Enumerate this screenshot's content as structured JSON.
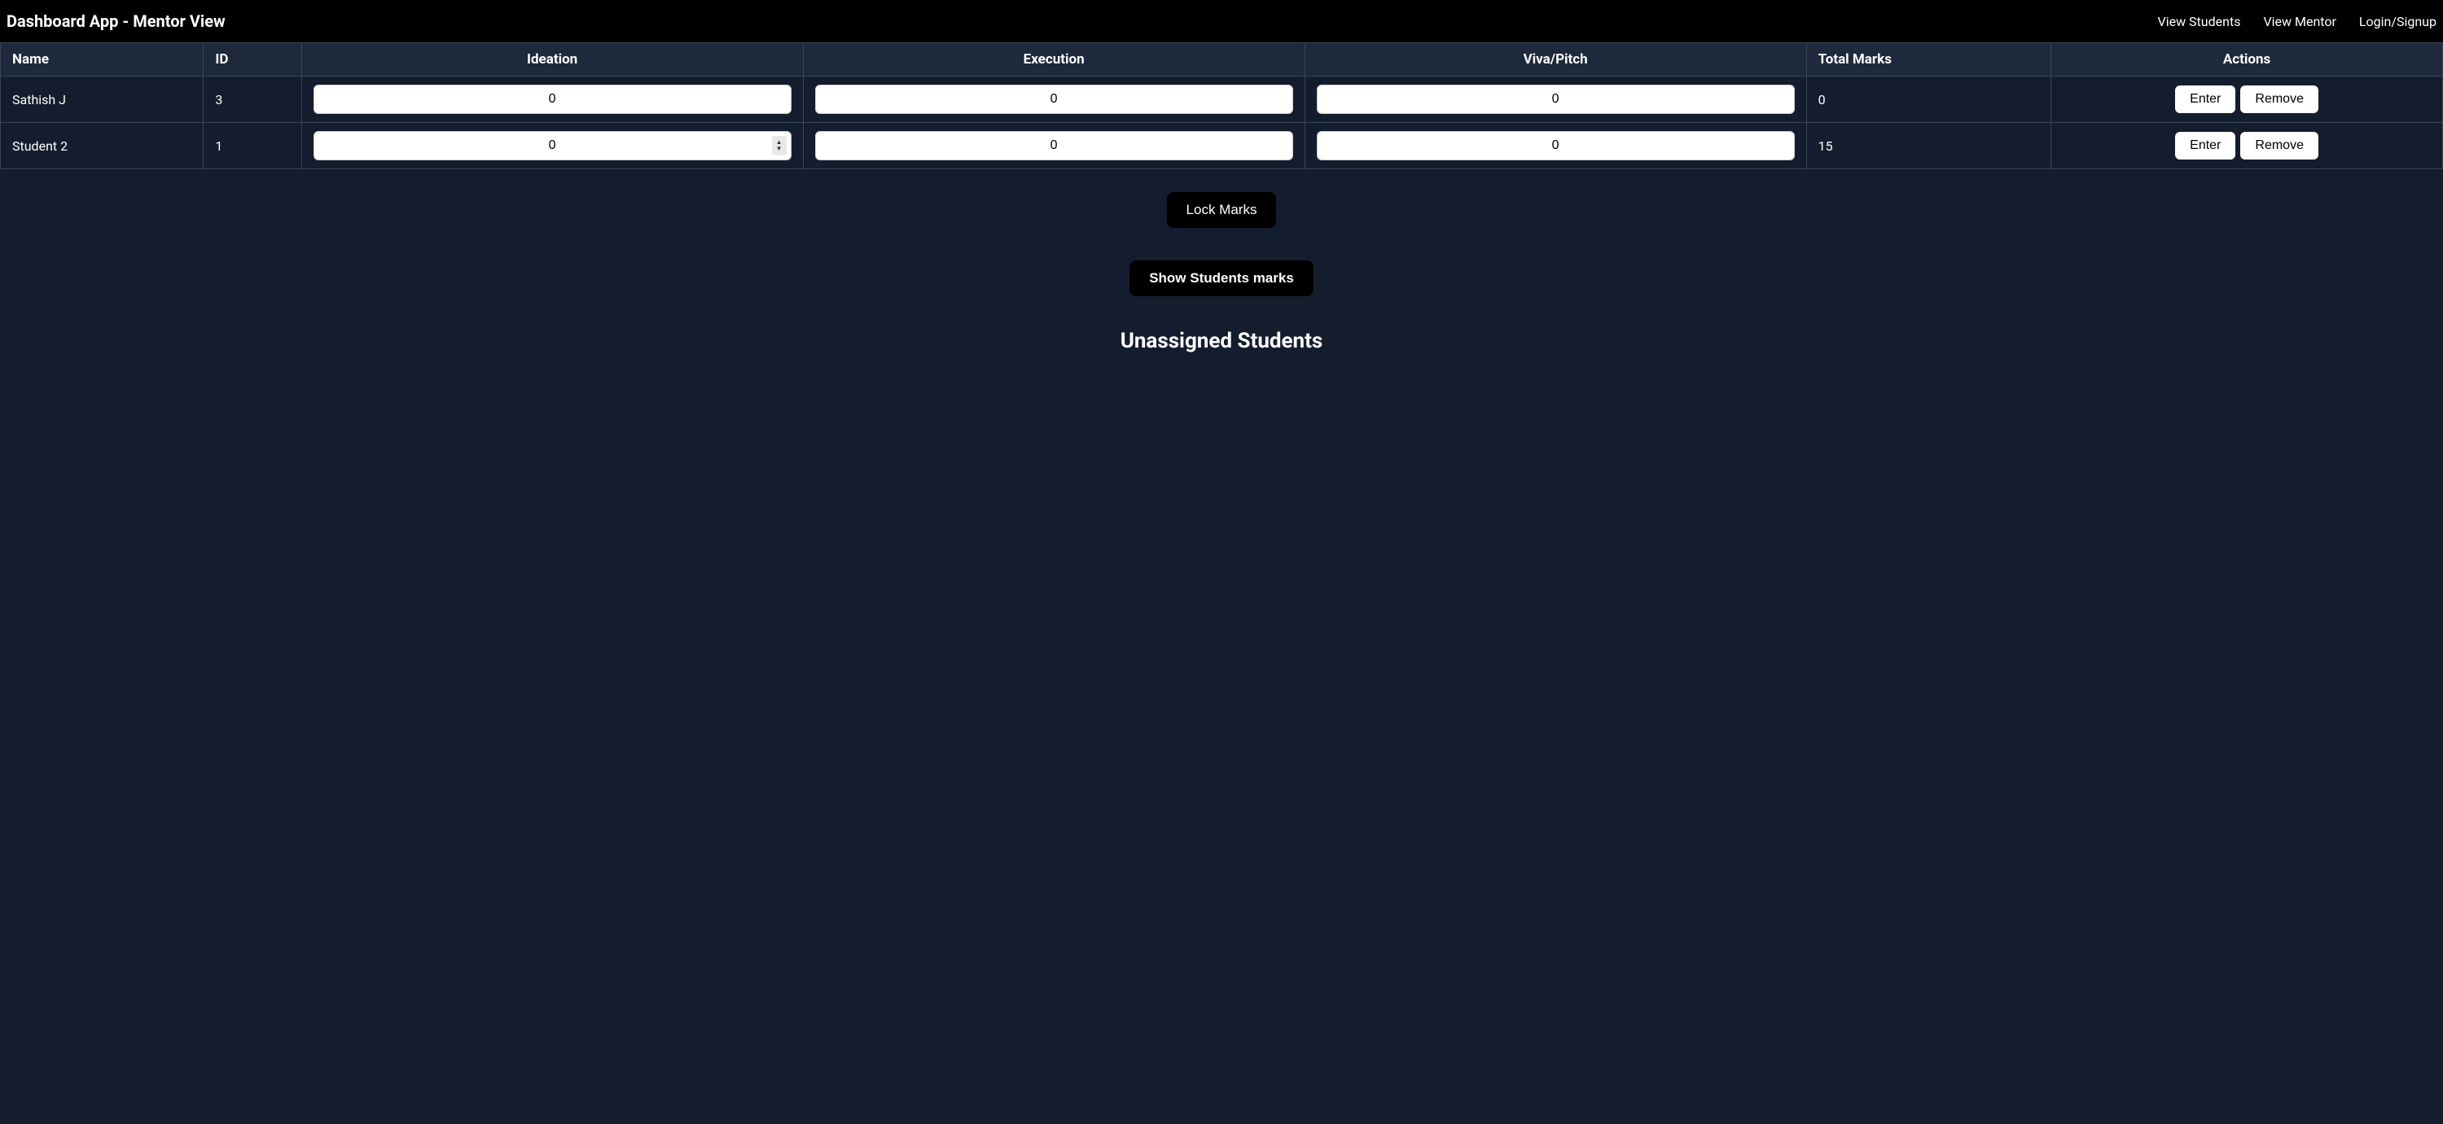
{
  "navbar": {
    "title": "Dashboard App - Mentor View",
    "links": {
      "view_students": "View Students",
      "view_mentor": "View Mentor",
      "login_signup": "Login/Signup"
    }
  },
  "table": {
    "headers": {
      "name": "Name",
      "id": "ID",
      "ideation": "Ideation",
      "execution": "Execution",
      "viva": "Viva/Pitch",
      "total": "Total Marks",
      "actions": "Actions"
    },
    "rows": [
      {
        "name": "Sathish J",
        "id": "3",
        "ideation": "0",
        "execution": "0",
        "viva": "0",
        "total": "0",
        "show_spinner": false
      },
      {
        "name": "Student 2",
        "id": "1",
        "ideation": "0",
        "execution": "0",
        "viva": "0",
        "total": "15",
        "show_spinner": true
      }
    ],
    "action_labels": {
      "enter": "Enter",
      "remove": "Remove"
    }
  },
  "buttons": {
    "lock_marks": "Lock Marks",
    "show_students_marks": "Show Students marks"
  },
  "headings": {
    "unassigned": "Unassigned Students"
  }
}
